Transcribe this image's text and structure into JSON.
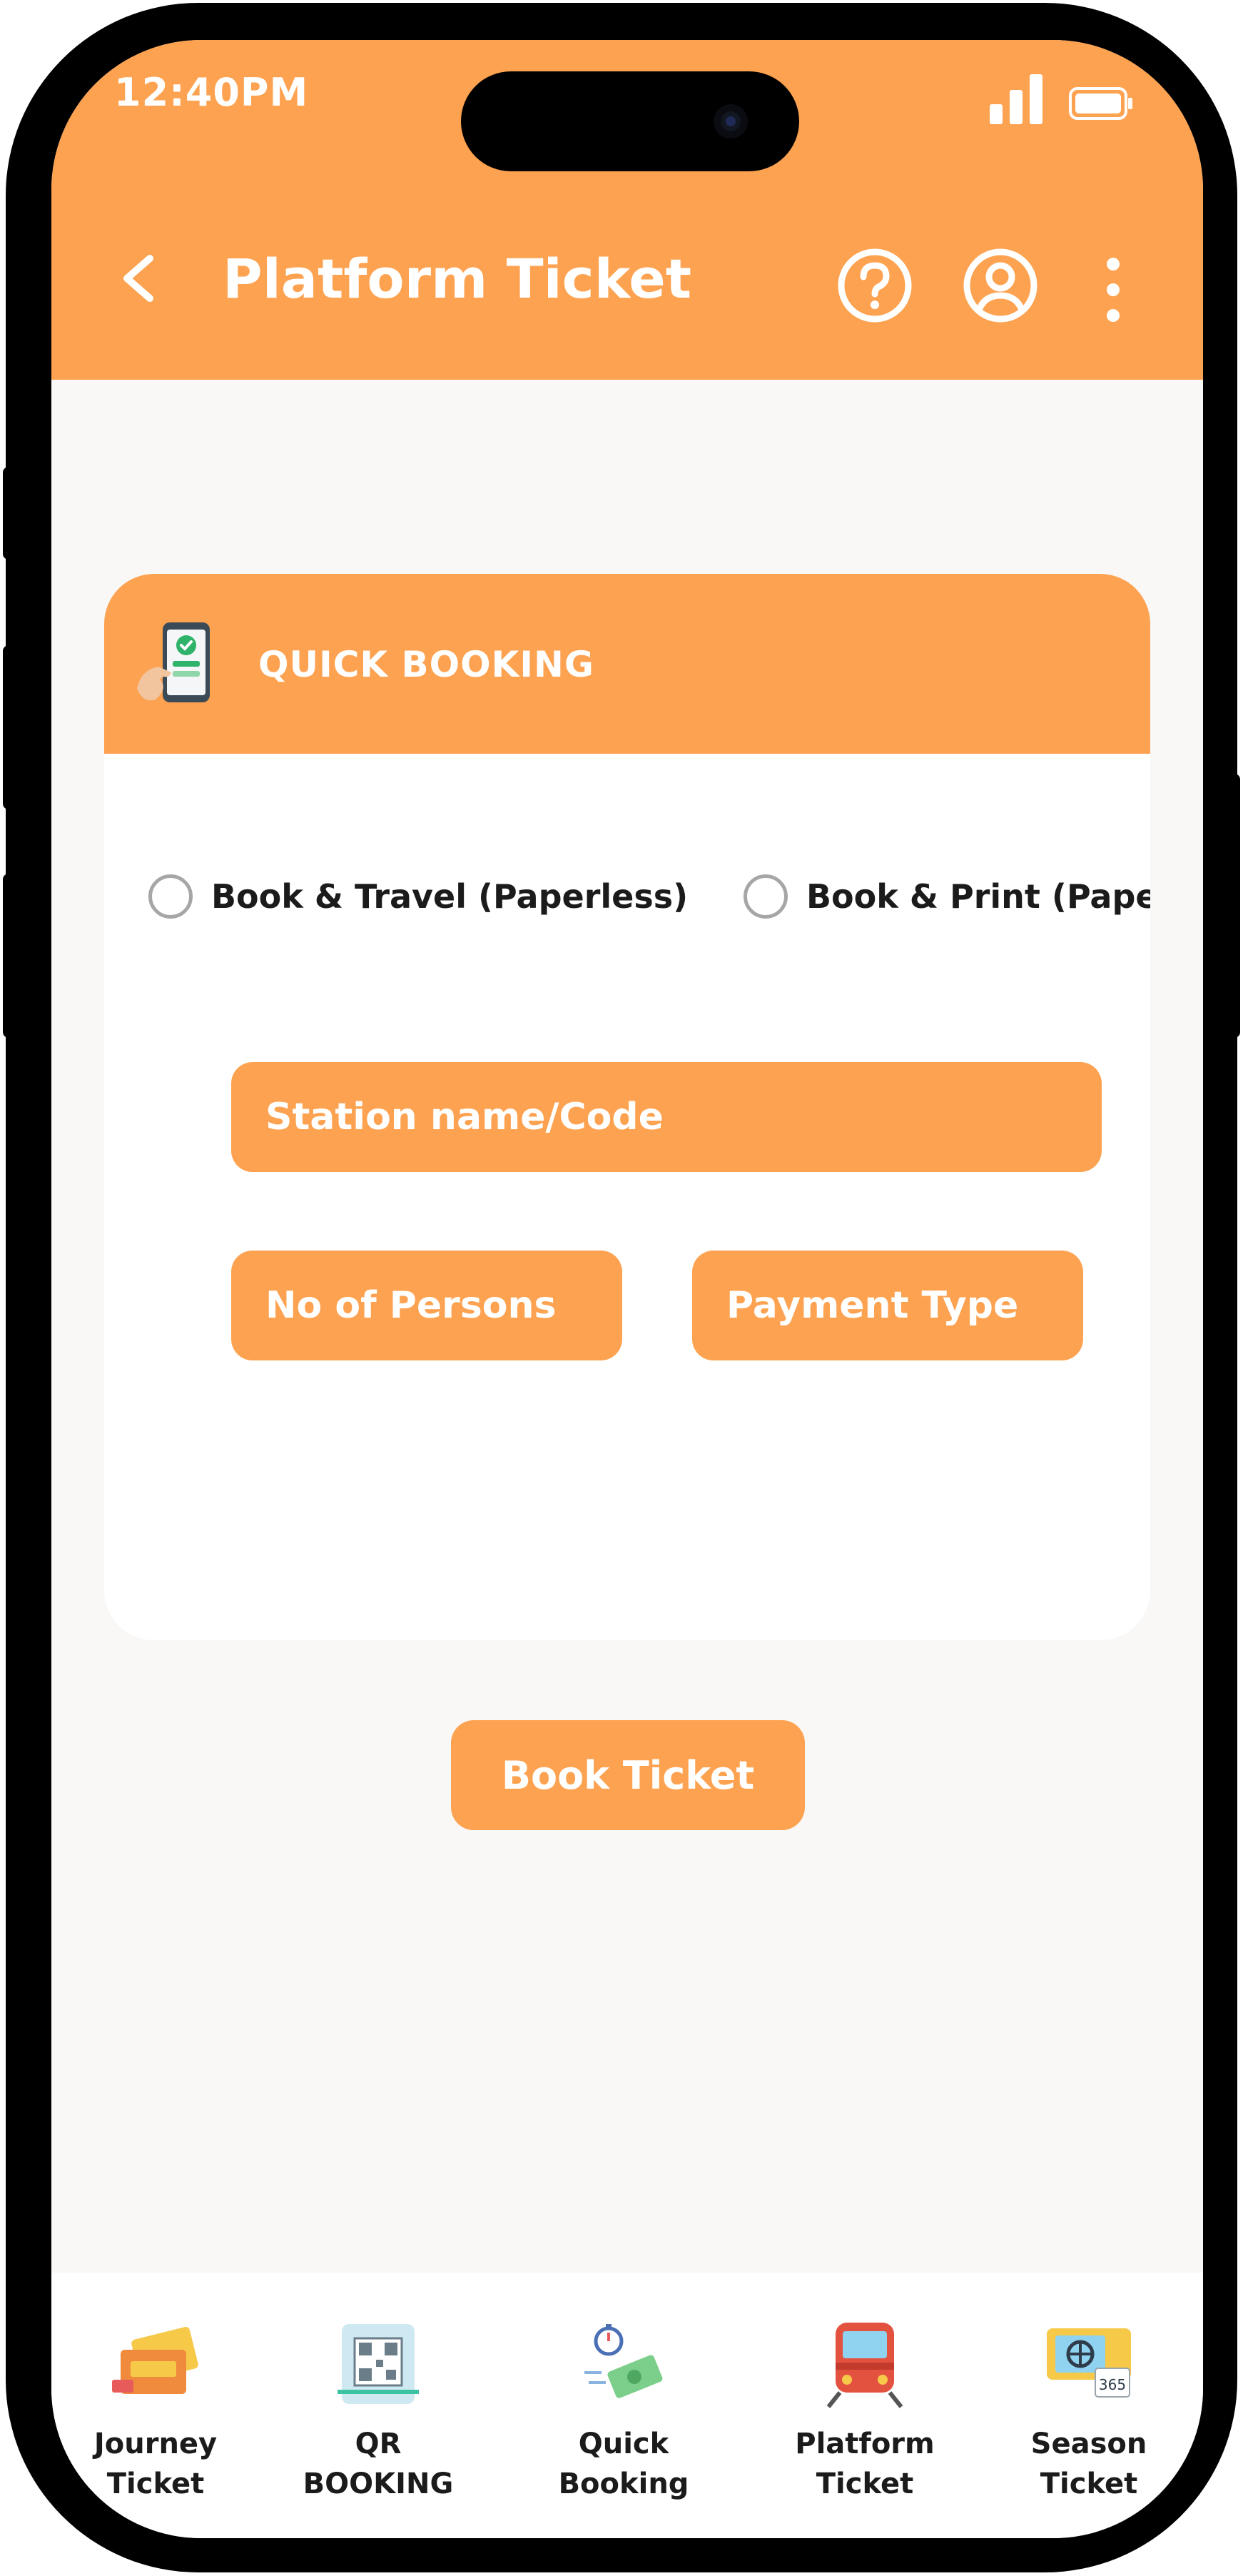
{
  "status_bar": {
    "time": "12:40PM"
  },
  "header": {
    "title": "Platform Ticket"
  },
  "icons": {
    "back": "chevron-left-icon",
    "help": "help-circle-icon",
    "account": "account-circle-icon",
    "more": "more-vertical-icon"
  },
  "card": {
    "title": "QUICK BOOKING",
    "options": [
      {
        "label": "Book & Travel (Paperless)",
        "selected": false
      },
      {
        "label": "Book & Print (Paper)",
        "selected": false
      }
    ],
    "fields": {
      "station": "Station name/Code",
      "persons": "No of Persons",
      "payment": "Payment Type"
    }
  },
  "book_button": "Book Ticket",
  "nav": [
    {
      "label": "Journey\nTicket",
      "icon": "journey-ticket-icon"
    },
    {
      "label": "QR\nBOOKING",
      "icon": "qr-booking-icon"
    },
    {
      "label": "Quick\nBooking",
      "icon": "quick-booking-icon"
    },
    {
      "label": "Platform\nTicket",
      "icon": "platform-ticket-icon"
    },
    {
      "label": "Season\nTicket",
      "icon": "season-ticket-icon"
    }
  ],
  "colors": {
    "accent": "#fda250",
    "background": "#f9f8f6",
    "text": "#1b1b1b"
  }
}
